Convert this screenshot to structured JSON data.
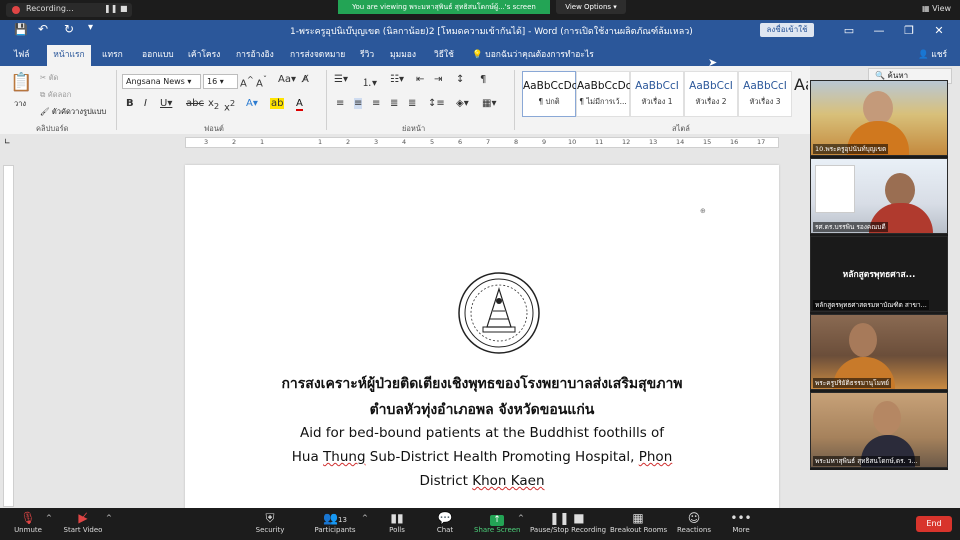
{
  "zoom_top": {
    "recording_label": "Recording...",
    "pause_glyph": "❚❚",
    "stop_glyph": "■",
    "share_banner": "You are viewing พระมหาสุพินธ์ สุทธิสนโดกษ์ผู้...'s screen",
    "view_options": "View Options ▾",
    "view_label": "View"
  },
  "word": {
    "doc_title": "1-พระครูอุปนิเบ๊บุญเขต (นิลกาน้อย)2 [โหมดความเข้ากันได้] - Word (การเปิดใช้งานผลิตภัณฑ์ล้มเหลว)",
    "signin_label": "ลงชื่อเข้าใช้",
    "tabs": [
      "ไฟล์",
      "หน้าแรก",
      "แทรก",
      "ออกแบบ",
      "เค้าโครง",
      "การอ้างอิง",
      "การส่งจดหมาย",
      "รีวิว",
      "มุมมอง",
      "วิธีใช้"
    ],
    "tell_me": "บอกฉันว่าคุณต้องการทำอะไร",
    "share": "แชร์",
    "clipboard": {
      "paste": "วาง",
      "cut": "ตัด",
      "copy": "คัดลอก",
      "format_painter": "ตัวคัดวางรูปแบบ",
      "group": "คลิปบอร์ด"
    },
    "font": {
      "name": "Angsana News",
      "size": "16",
      "group": "ฟอนต์"
    },
    "paragraph_group": "ย่อหน้า",
    "styles_group": "สไตล์",
    "styles": [
      {
        "sample": "AaBbCcDc",
        "name": "¶ ปกติ"
      },
      {
        "sample": "AaBbCcDc",
        "name": "¶ ไม่มีการเว้..."
      },
      {
        "sample": "AaBbCcI",
        "name": "หัวเรื่อง 1"
      },
      {
        "sample": "AaBbCcI",
        "name": "หัวเรื่อง 2"
      },
      {
        "sample": "AaBbCcI",
        "name": "หัวเรื่อง 3"
      },
      {
        "sample": "AaB",
        "name": ""
      }
    ],
    "find_label": "ค้นหา",
    "ruler_numbers": [
      "3",
      "2",
      "1",
      "1",
      "2",
      "3",
      "4",
      "5",
      "6",
      "7",
      "8",
      "9",
      "10",
      "11",
      "12",
      "13",
      "14",
      "15",
      "16",
      "17"
    ]
  },
  "document": {
    "thai_line1": "การสงเคราะห์ผู้ป่วยติดเตียงเชิงพุทธของโรงพยาบาลส่งเสริมสุขภาพ",
    "thai_line2": "ตำบลหัวทุ่งอำเภอพล จังหวัดขอนแก่น",
    "eng_line1": "Aid for bed-bound patients at the Buddhist foothills of",
    "eng_line2_a": "Hua ",
    "eng_line2_b": "Thung",
    "eng_line2_c": " Sub-District Health Promoting Hospital, ",
    "eng_line2_d": "Phon",
    "eng_line3_a": "District ",
    "eng_line3_b": "Khon Kaen"
  },
  "videos": [
    {
      "name": "10.พระครูอุปนันท์บุญเขต"
    },
    {
      "name": "รศ.ดร.บรรพิน รองคณบดี"
    },
    {
      "name": "หลักสูตรพุทธศาสตรมหาบัณฑิต สาขา...",
      "title": "หลักสูตรพุทธศาส..."
    },
    {
      "name": "พระครูปริยัติธรรมานุโมทย์"
    },
    {
      "name": "พระมหาสุพินธ์ สุทธิสนโดกษ์,ดร. ว..."
    }
  ],
  "zoom_bottom": {
    "unmute": "Unmute",
    "start_video": "Start Video",
    "security": "Security",
    "participants": "Participants",
    "participants_count": "13",
    "polls": "Polls",
    "chat": "Chat",
    "share_screen": "Share Screen",
    "pause_recording": "Pause/Stop Recording",
    "breakout": "Breakout Rooms",
    "reactions": "Reactions",
    "more": "More",
    "end": "End"
  }
}
